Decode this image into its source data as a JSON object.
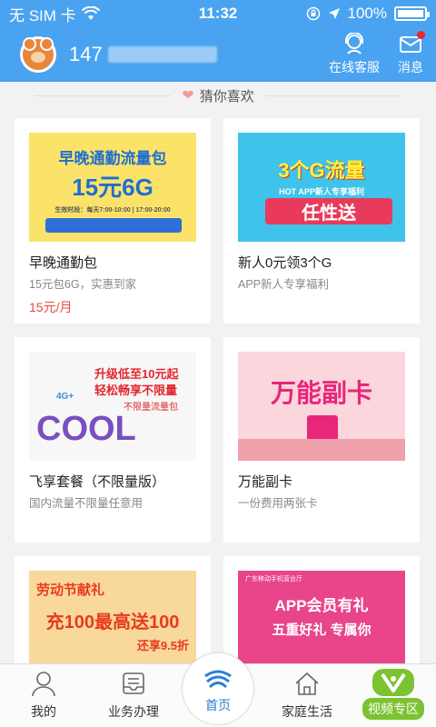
{
  "status_bar": {
    "carrier": "无 SIM 卡",
    "time": "11:32",
    "battery": "100%",
    "icons": [
      "wifi-icon",
      "orientation-lock-icon",
      "location-icon",
      "battery-icon"
    ]
  },
  "header": {
    "phone_prefix": "147",
    "actions": [
      {
        "label": "在线客服",
        "icon": "customer-service-icon"
      },
      {
        "label": "消息",
        "icon": "mail-icon",
        "has_badge": true
      }
    ]
  },
  "section": {
    "title": "猜你喜欢",
    "icon": "heart-icon"
  },
  "cards": [
    {
      "banner_line1": "早晚通勤流量包",
      "banner_line2": "15元6G",
      "banner_note": "生效时段：每天7:00-10:00 | 17:00-20:00",
      "title": "早晚通勤包",
      "sub": "15元包6G，实惠到家",
      "price": "15元/月"
    },
    {
      "banner_line1": "3个G流量",
      "banner_line2": "任性送",
      "banner_note": "HOT APP新人专享福利",
      "title": "新人0元领3个G",
      "sub": "APP新人专享福利"
    },
    {
      "banner_line1": "升级低至10元起",
      "banner_line2": "轻松畅享不限量",
      "banner_note": "不限量流量包",
      "banner_badge": "4G+",
      "banner_word": "COOL",
      "title": "飞享套餐（不限量版）",
      "sub": "国内流量不限量任意用"
    },
    {
      "banner_line1": "万能副卡",
      "title": "万能副卡",
      "sub": "一份费用两张卡"
    },
    {
      "banner_line1": "劳动节献礼",
      "banner_line2": "充100最高送100",
      "banner_note": "还享9.5折"
    },
    {
      "banner_line1": "APP会员有礼",
      "banner_line2": "五重好礼 专属你",
      "banner_note": "广东移动手机营业厅"
    }
  ],
  "tabs": [
    {
      "label": "我的",
      "icon": "person-icon"
    },
    {
      "label": "业务办理",
      "icon": "inbox-icon"
    },
    {
      "label": "首页",
      "icon": "china-mobile-logo-icon",
      "active": true
    },
    {
      "label": "家庭生活",
      "icon": "house-icon"
    },
    {
      "label": "视频专区",
      "icon": "video-logo-icon"
    }
  ],
  "colors": {
    "brand": "#4aa3f0",
    "price": "#e84a3c",
    "active_tab": "#2a7fd4",
    "video": "#7bc331"
  }
}
